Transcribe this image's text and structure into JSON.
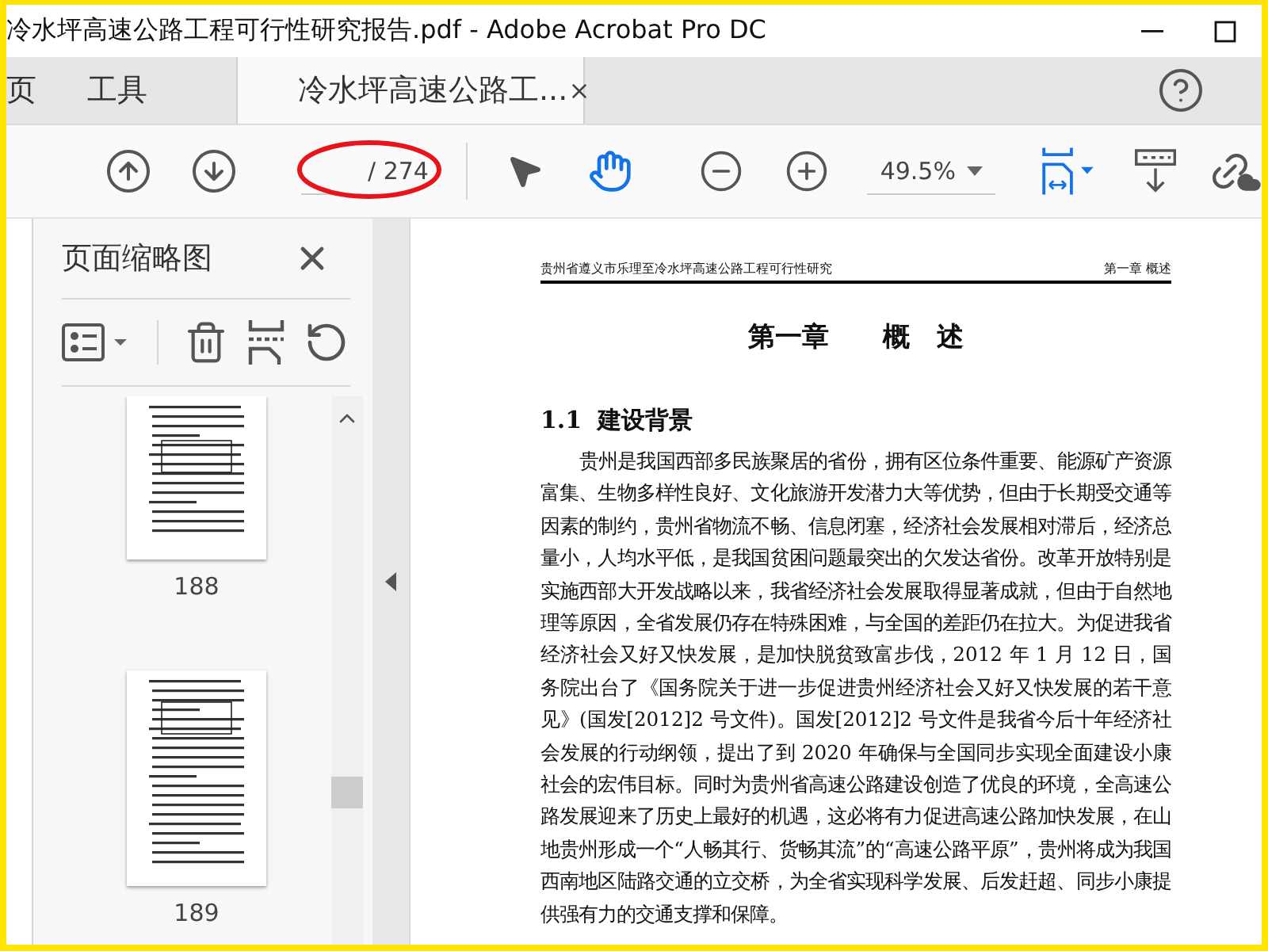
{
  "window": {
    "title": "冷水坪高速公路工程可行性研究报告.pdf - Adobe Acrobat Pro DC"
  },
  "tabs": [
    {
      "label": "页",
      "kind": "nav",
      "selected": false
    },
    {
      "label": "工具",
      "kind": "nav",
      "selected": false
    },
    {
      "label": "冷水坪高速公路工...",
      "kind": "document",
      "selected": true
    }
  ],
  "toolbar": {
    "page_total": "/ 274",
    "zoom": "49.5%",
    "tools": [
      {
        "kind": "select",
        "selected": false
      },
      {
        "kind": "hand",
        "selected": true
      }
    ]
  },
  "sidebar": {
    "title": "页面缩略图",
    "thumbnails": [
      {
        "label": "188"
      },
      {
        "label": "189"
      }
    ]
  },
  "document": {
    "header_left": "贵州省遵义市乐理至冷水坪高速公路工程可行性研究",
    "header_right": "第一章 概述",
    "chapter_title": "第一章　　概　述",
    "section_number": "1.1",
    "section_title": "建设背景",
    "paragraph": "贵州是我国西部多民族聚居的省份，拥有区位条件重要、能源矿产资源富集、生物多样性良好、文化旅游开发潜力大等优势，但由于长期受交通等因素的制约，贵州省物流不畅、信息闭塞，经济社会发展相对滞后，经济总量小，人均水平低，是我国贫困问题最突出的欠发达省份。改革开放特别是实施西部大开发战略以来，我省经济社会发展取得显著成就，但由于自然地理等原因，全省发展仍存在特殊困难，与全国的差距仍在拉大。为促进我省经济社会又好又快发展，是加快脱贫致富步伐，2012 年 1 月 12 日，国务院出台了《国务院关于进一步促进贵州经济社会又好又快发展的若干意见》(国发[2012]2 号文件)。国发[2012]2 号文件是我省今后十年经济社会发展的行动纲领，提出了到 2020 年确保与全国同步实现全面建设小康社会的宏伟目标。同时为贵州省高速公路建设创造了优良的环境，全高速公路发展迎来了历史上最好的机遇，这必将有力促进高速公路加快发展，在山地贵州形成一个“人畅其行、货畅其流”的“高速公路平原”，贵州将成为我国西南地区陆路交通的立交桥，为全省实现科学发展、后发赶超、同步小康提供强有力的交通支撑和保障。"
  }
}
